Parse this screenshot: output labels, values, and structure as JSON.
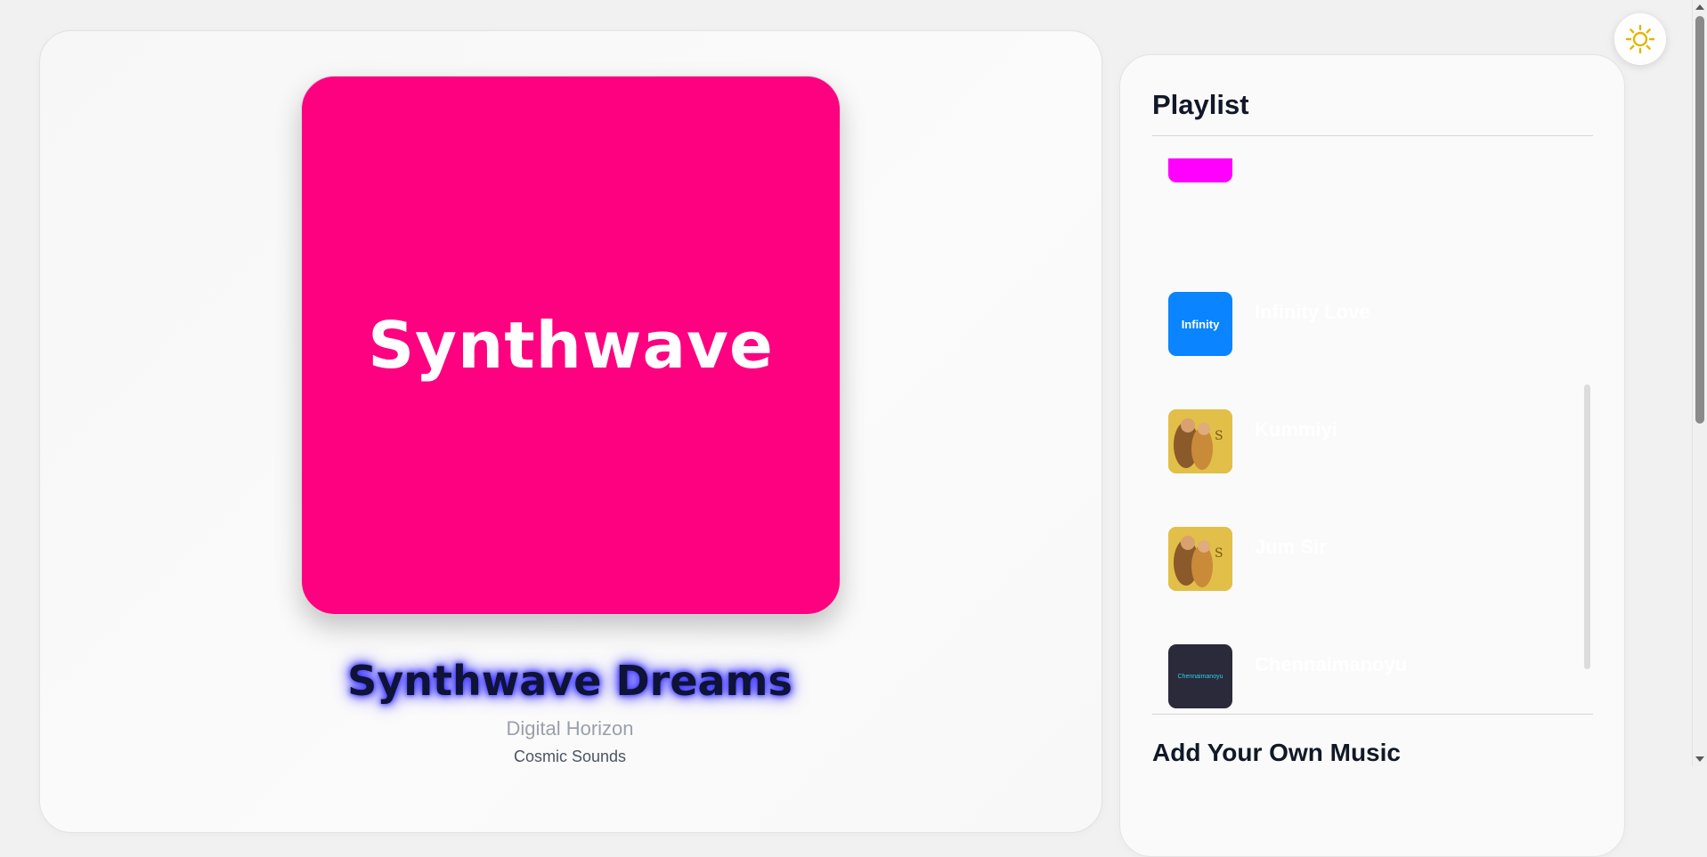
{
  "now_playing": {
    "cover_text": "Synthwave",
    "cover_color": "#fe0180",
    "title": "Synthwave Dreams",
    "artist": "Digital Horizon",
    "album": "Cosmic Sounds"
  },
  "playlist": {
    "title": "Playlist",
    "items": [
      {
        "title": "",
        "subtitle": "",
        "thumb_text": "",
        "thumb_color": "#ff00ff"
      },
      {
        "title": "Infinity Love",
        "subtitle": "",
        "thumb_text": "Infinity",
        "thumb_color": "#0a84ff"
      },
      {
        "title": "Kummiyi",
        "subtitle": "",
        "thumb_text": "",
        "thumb_color": "#d9b13a"
      },
      {
        "title": "Jum Sir",
        "subtitle": "",
        "thumb_text": "",
        "thumb_color": "#d9b13a"
      },
      {
        "title": "Chennaimanoyu",
        "subtitle": "",
        "thumb_text": "Chennaimanoyu",
        "thumb_color": "#2a2a3a"
      }
    ]
  },
  "add_music": {
    "title": "Add Your Own Music"
  },
  "theme_toggle": {
    "icon": "sun-icon",
    "color": "#e6b400"
  }
}
